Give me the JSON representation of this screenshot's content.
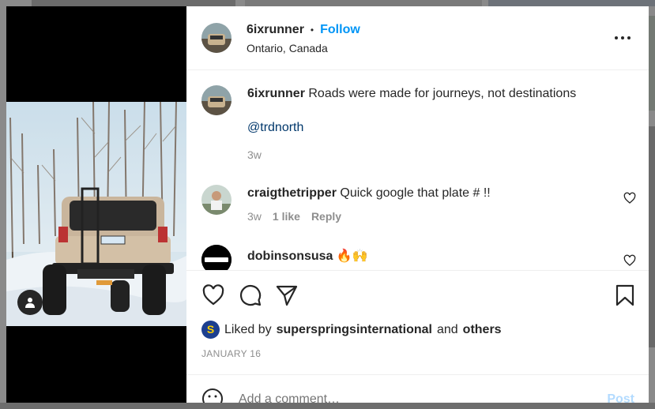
{
  "post": {
    "author": "6ixrunner",
    "follow_label": "Follow",
    "separator": "•",
    "location": "Ontario, Canada"
  },
  "caption": {
    "author": "6ixrunner",
    "text": "Roads were made for journeys, not destinations",
    "mention": "@trdnorth",
    "time": "3w"
  },
  "comments": [
    {
      "author": "craigthetripper",
      "text": "Quick google that plate # !!",
      "time": "3w",
      "likes": "1 like",
      "reply": "Reply"
    },
    {
      "author": "dobinsonsusa",
      "text": "🔥🙌"
    }
  ],
  "likes": {
    "prefix": "Liked by",
    "user": "superspringsinternational",
    "conj": "and",
    "others": "others"
  },
  "date": "JANUARY 16",
  "add_comment": {
    "placeholder": "Add a comment…",
    "post_label": "Post"
  },
  "colors": {
    "accent": "#0095f6",
    "post_disabled": "#b3dbff",
    "mention": "#00376b"
  },
  "icons": [
    "more-icon",
    "heart-icon",
    "comment-icon",
    "share-icon",
    "bookmark-icon",
    "emoji-icon",
    "user-tag-icon"
  ]
}
